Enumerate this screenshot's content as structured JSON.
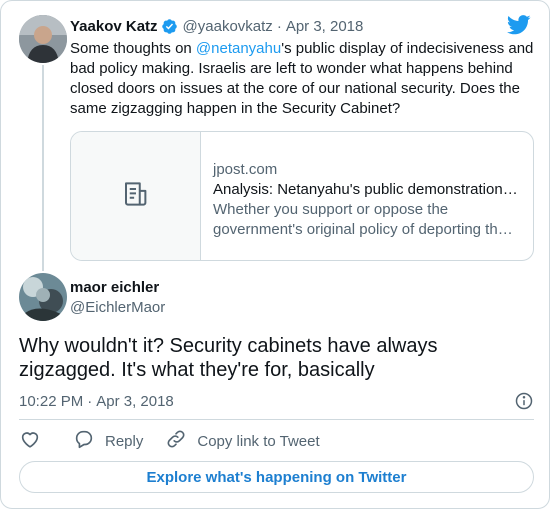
{
  "parent": {
    "name": "Yaakov Katz",
    "handle": "@yaakovkatz",
    "separator": "·",
    "date": "Apr 3, 2018",
    "text_before_mention": "Some thoughts on ",
    "mention": "@netanyahu",
    "text_after_mention": "'s public display of indecisiveness and bad policy making. Israelis are left to wonder what happens behind closed doors on issues at the core of our national security. Does the same zigzagging happen in the Security Cabinet?",
    "link_card": {
      "domain": "jpost.com",
      "title": "Analysis: Netanyahu's public demonstration…",
      "description": "Whether you support or oppose the government's original policy of deporting th…",
      "thumb_icon": "article-icon"
    }
  },
  "reply": {
    "name": "maor eichler",
    "handle": "@EichlerMaor",
    "text": "Why wouldn't it? Security cabinets have always zigzagged. It's what they're for, basically",
    "time": "10:22 PM",
    "separator": "·",
    "date": "Apr 3, 2018"
  },
  "actions": {
    "reply_label": "Reply",
    "copy_link_label": "Copy link to Tweet"
  },
  "explore_label": "Explore what's happening on Twitter",
  "colors": {
    "brand": "#1d9bf0",
    "text": "#0f1419",
    "secondary": "#536471",
    "border": "#cfd9de"
  }
}
